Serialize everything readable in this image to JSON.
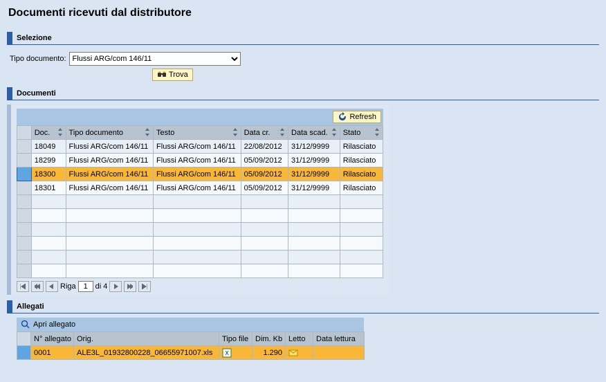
{
  "page": {
    "title": "Documenti ricevuti dal distributore"
  },
  "selection": {
    "panel_title": "Selezione",
    "label": "Tipo documento:",
    "value": "Flussi ARG/com 146/11",
    "find_label": "Trova"
  },
  "documents": {
    "panel_title": "Documenti",
    "refresh_label": "Refresh",
    "columns": {
      "doc": "Doc.",
      "tipo": "Tipo documento",
      "testo": "Testo",
      "data_cr": "Data cr.",
      "data_scad": "Data scad.",
      "stato": "Stato"
    },
    "rows": [
      {
        "doc": "18049",
        "tipo": "Flussi ARG/com 146/11",
        "testo": "Flussi ARG/com 146/11",
        "data_cr": "22/08/2012",
        "data_scad": "31/12/9999",
        "stato": "Rilasciato",
        "selected": false
      },
      {
        "doc": "18299",
        "tipo": "Flussi ARG/com 146/11",
        "testo": "Flussi ARG/com 146/11",
        "data_cr": "05/09/2012",
        "data_scad": "31/12/9999",
        "stato": "Rilasciato",
        "selected": false
      },
      {
        "doc": "18300",
        "tipo": "Flussi ARG/com 146/11",
        "testo": "Flussi ARG/com 146/11",
        "data_cr": "05/09/2012",
        "data_scad": "31/12/9999",
        "stato": "Rilasciato",
        "selected": true
      },
      {
        "doc": "18301",
        "tipo": "Flussi ARG/com 146/11",
        "testo": "Flussi ARG/com 146/11",
        "data_cr": "05/09/2012",
        "data_scad": "31/12/9999",
        "stato": "Rilasciato",
        "selected": false
      }
    ],
    "empty_rows": 6,
    "pager": {
      "label_prefix": "Riga",
      "current": "1",
      "label_suffix": "di 4"
    }
  },
  "attachments": {
    "panel_title": "Allegati",
    "open_label": "Apri allegato",
    "columns": {
      "n": "N° allegato",
      "orig": "Orig.",
      "tipo_file": "Tipo file",
      "dim": "Dim. Kb",
      "letto": "Letto",
      "data_lettura": "Data lettura"
    },
    "rows": [
      {
        "n": "0001",
        "orig": "ALE3L_01932800228_06655971007.xls",
        "tipo_file_icon": "xls-icon",
        "dim": "1.290",
        "letto_icon": "mail-icon",
        "data_lettura": ""
      }
    ]
  },
  "icons": {
    "binoculars": "binoculars-icon",
    "refresh": "refresh-icon",
    "magnifier": "magnifier-icon"
  }
}
